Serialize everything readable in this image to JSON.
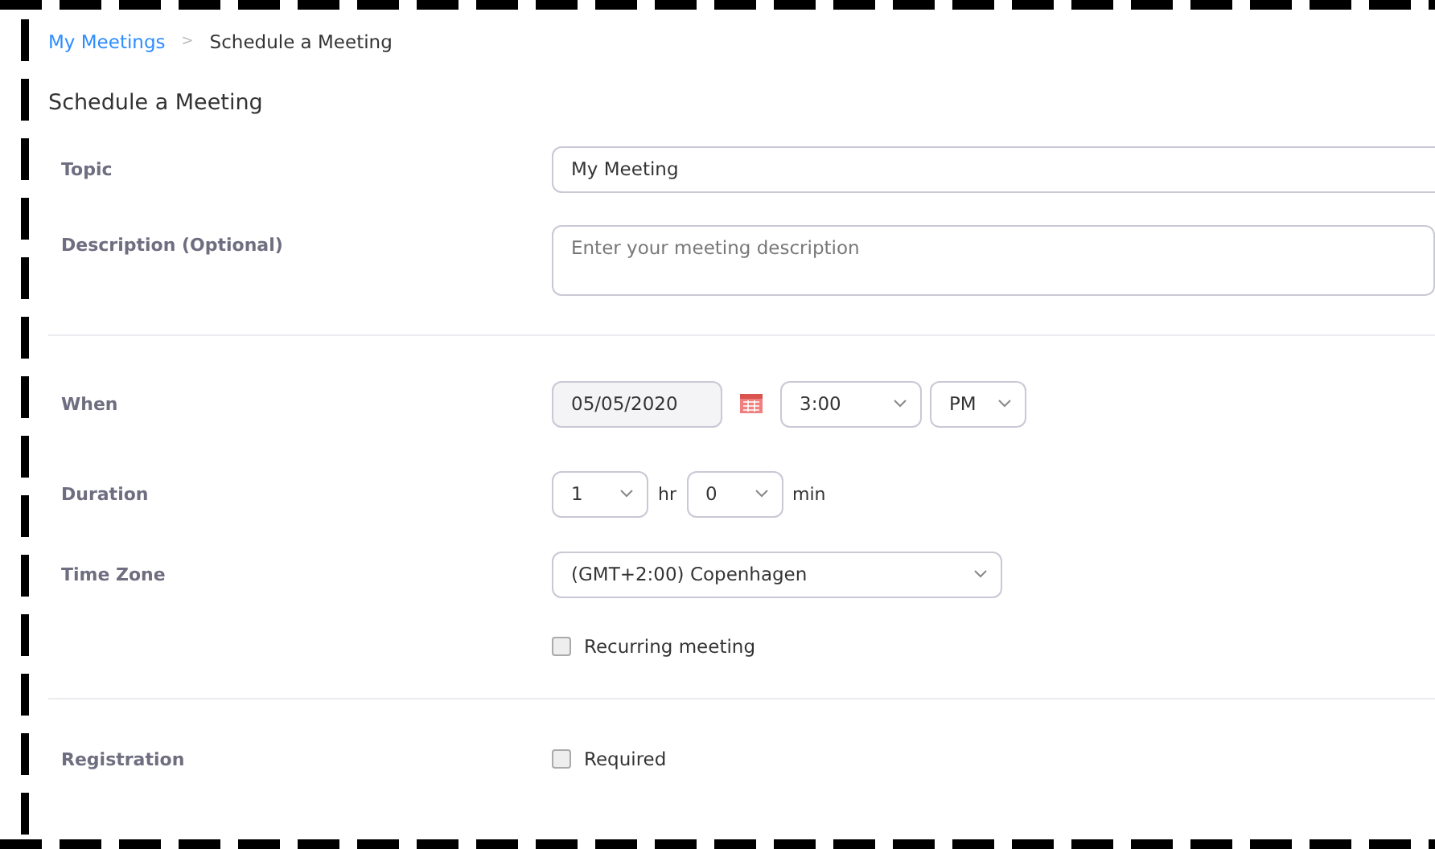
{
  "breadcrumb": [
    {
      "label": "My Meetings",
      "kind": "link"
    },
    {
      "label": "Schedule a Meeting",
      "kind": "current"
    }
  ],
  "breadcrumb_separator": ">",
  "title": "Schedule a Meeting",
  "topic": {
    "label": "Topic",
    "value": "My Meeting"
  },
  "description": {
    "label": "Description (Optional)",
    "placeholder": "Enter your meeting description"
  },
  "when": {
    "label": "When",
    "date": "05/05/2020",
    "time": "3:00",
    "ampm": "PM"
  },
  "duration": {
    "label": "Duration",
    "hours": "1",
    "hours_unit": "hr",
    "minutes": "0",
    "minutes_unit": "min"
  },
  "time_zone": {
    "label": "Time Zone",
    "value": "(GMT+2:00) Copenhagen"
  },
  "recurring": {
    "label": "Recurring meeting",
    "checked": false
  },
  "registration": {
    "label": "Registration",
    "option": "Required",
    "checked": false
  }
}
